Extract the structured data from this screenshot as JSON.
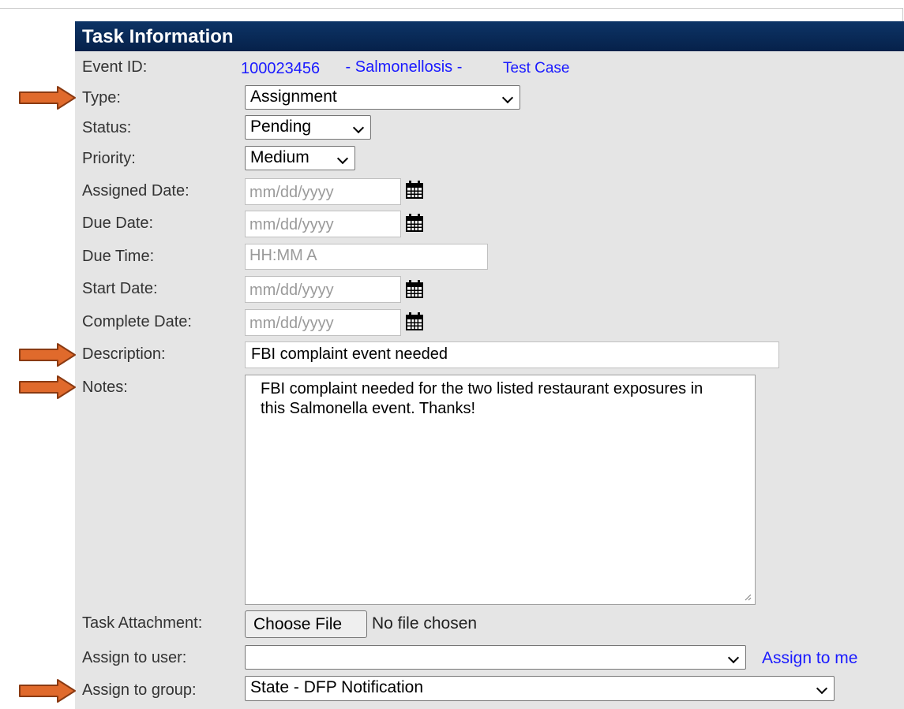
{
  "panel": {
    "title": "Task Information"
  },
  "event": {
    "label": "Event ID:",
    "id": "100023456",
    "disease": " - Salmonellosis - ",
    "case": "Test Case"
  },
  "fields": {
    "type": {
      "label": "Type:",
      "value": "Assignment"
    },
    "status": {
      "label": "Status:",
      "value": "Pending"
    },
    "priority": {
      "label": "Priority:",
      "value": "Medium"
    },
    "assigned_date": {
      "label": "Assigned Date:",
      "placeholder": "mm/dd/yyyy"
    },
    "due_date": {
      "label": "Due Date:",
      "placeholder": "mm/dd/yyyy"
    },
    "due_time": {
      "label": "Due Time:",
      "placeholder": "HH:MM A"
    },
    "start_date": {
      "label": "Start Date:",
      "placeholder": "mm/dd/yyyy"
    },
    "complete_date": {
      "label": "Complete Date:",
      "placeholder": "mm/dd/yyyy"
    },
    "description": {
      "label": "Description:",
      "value": "FBI complaint event needed"
    },
    "notes": {
      "label": "Notes:",
      "value": "FBI complaint needed for the two listed restaurant exposures in this Salmonella event. Thanks!"
    },
    "attachment": {
      "label": "Task Attachment:",
      "button": "Choose File",
      "status": "No file chosen"
    },
    "assign_user": {
      "label": "Assign to user:",
      "value": "",
      "link": "Assign to me"
    },
    "assign_group": {
      "label": "Assign to group:",
      "value": "State - DFP Notification"
    }
  },
  "colors": {
    "header_bg": "#0d3466",
    "panel_bg": "#e5e5e5",
    "link": "#1a1aff",
    "arrow": "#e06a2c"
  },
  "icons": {
    "calendar": "calendar-icon",
    "dropdown": "chevron-down-icon",
    "arrow": "arrow-right-icon"
  }
}
